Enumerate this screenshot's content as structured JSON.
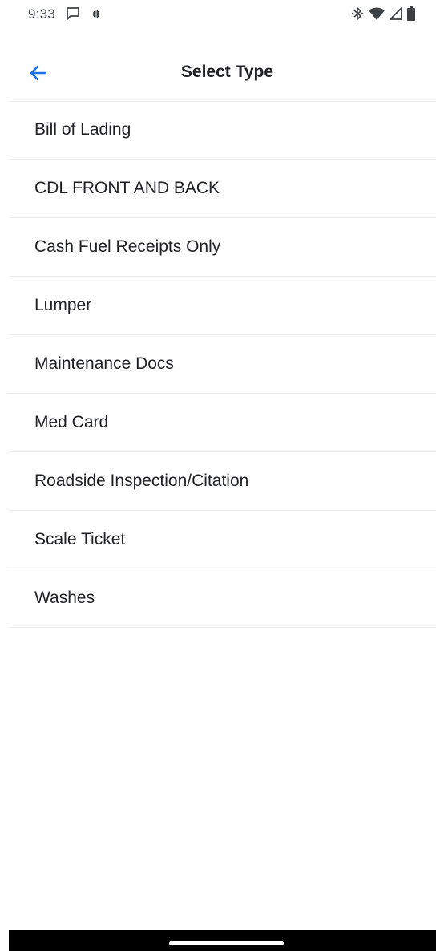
{
  "status_bar": {
    "time": "9:33",
    "left_icons": [
      "chat-notification-icon",
      "bug-notification-icon"
    ],
    "right_icons": [
      "bluetooth-icon",
      "wifi-icon",
      "cell-signal-icon",
      "battery-icon"
    ]
  },
  "app_bar": {
    "back_icon": "arrow-left-icon",
    "title": "Select Type"
  },
  "types": [
    "Bill of Lading",
    "CDL FRONT AND BACK",
    "Cash Fuel Receipts Only",
    "Lumper",
    "Maintenance Docs",
    "Med Card",
    "Roadside Inspection/Citation",
    "Scale Ticket",
    "Washes"
  ],
  "colors": {
    "accent": "#1a73e8",
    "text": "#202124",
    "divider": "#eeeeee"
  }
}
